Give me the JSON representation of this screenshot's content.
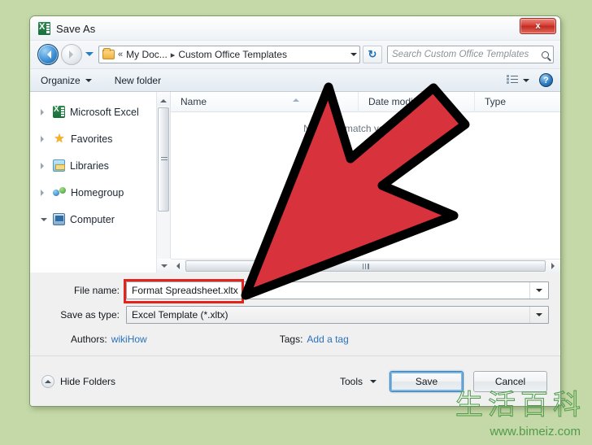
{
  "window": {
    "title": "Save As",
    "app_icon": "excel-icon",
    "close_label": "x"
  },
  "nav": {
    "back_icon": "back-arrow-icon",
    "forward_icon": "forward-arrow-icon",
    "recent_icon": "recent-pages-icon",
    "folder_icon": "folder-icon",
    "breadcrumb_prefix": "«",
    "breadcrumb": [
      "My Doc...",
      "Custom Office Templates"
    ],
    "separator": "▸",
    "refresh_icon": "refresh-icon",
    "refresh_glyph": "↻",
    "search_placeholder": "Search Custom Office Templates",
    "search_value": "",
    "search_icon": "search-icon"
  },
  "toolbar": {
    "organize_label": "Organize",
    "new_folder_label": "New folder",
    "view_icon": "view-options-icon",
    "help_icon": "help-icon",
    "help_glyph": "?"
  },
  "sidebar": {
    "items": [
      {
        "label": "Microsoft Excel",
        "icon": "excel-icon",
        "expanded": false
      },
      {
        "label": "Favorites",
        "icon": "star-icon",
        "expanded": false
      },
      {
        "label": "Libraries",
        "icon": "libraries-icon",
        "expanded": false
      },
      {
        "label": "Homegroup",
        "icon": "homegroup-icon",
        "expanded": false
      },
      {
        "label": "Computer",
        "icon": "computer-icon",
        "expanded": true
      }
    ],
    "scrollbar": {
      "up_icon": "scroll-up-icon",
      "down_icon": "scroll-down-icon",
      "thumb": "vertical-scroll-thumb"
    }
  },
  "filelist": {
    "columns": [
      "Name",
      "Date modified",
      "Type"
    ],
    "empty_message": "No items match your search.",
    "rows": [],
    "hscroll": {
      "left_icon": "scroll-left-icon",
      "right_icon": "scroll-right-icon",
      "thumb": "horizontal-scroll-thumb"
    }
  },
  "form": {
    "file_name_label": "File name:",
    "file_name_value": "Format Spreadsheet.xltx",
    "save_as_type_label": "Save as type:",
    "save_as_type_value": "Excel Template (*.xltx)",
    "authors_label": "Authors:",
    "authors_value": "wikiHow",
    "tags_label": "Tags:",
    "tags_value": "Add a tag",
    "highlight_color": "#e5231b"
  },
  "footer": {
    "hide_folders_label": "Hide Folders",
    "hide_folders_icon": "chevron-up-circle-icon",
    "tools_label": "Tools",
    "save_label": "Save",
    "cancel_label": "Cancel",
    "focus_color": "#7eb4e2"
  },
  "annotation": {
    "arrow_color": "#d8323c",
    "arrow_outline": "#000000",
    "arrow_name": "red-pointer-arrow"
  },
  "watermark": {
    "text_cn": "生活百科",
    "url": "www.bimeiz.com",
    "color": "#4f9b4a"
  }
}
